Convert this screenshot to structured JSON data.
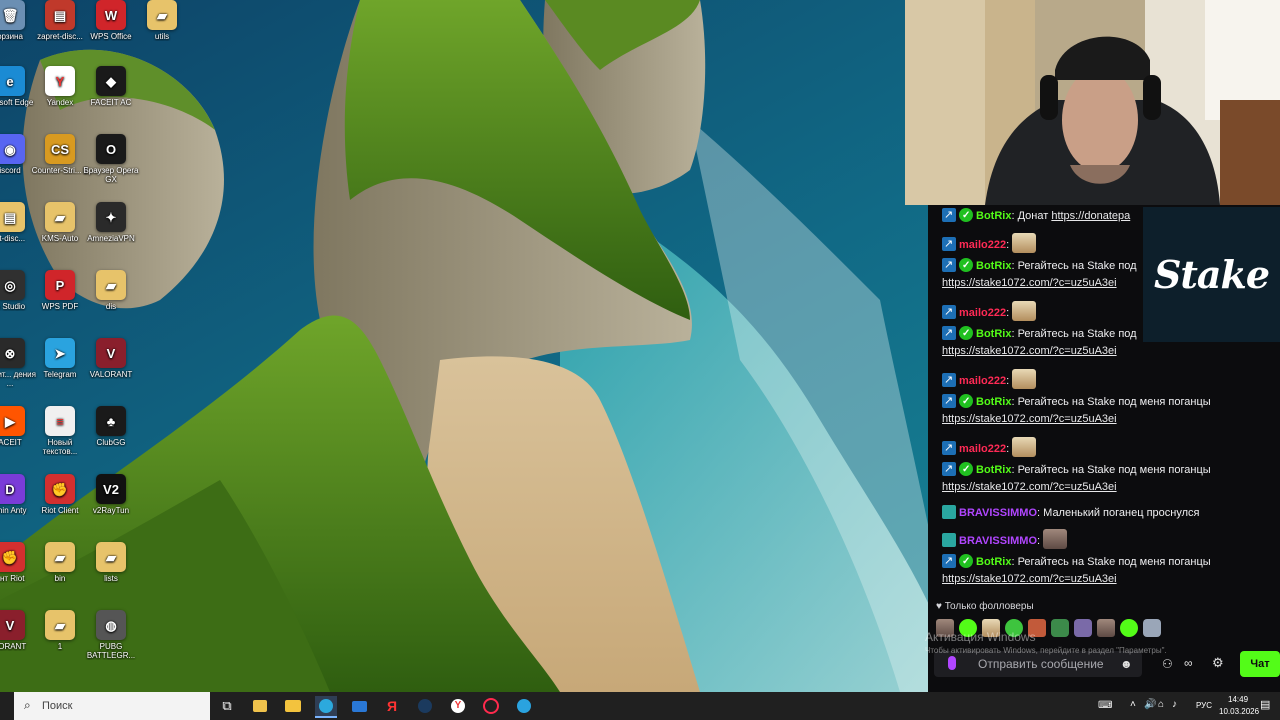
{
  "desktop": {
    "icons": [
      {
        "label": "орзина",
        "color": "#6b8fb3",
        "glyph": "🗑"
      },
      {
        "label": "zapret-disc...",
        "color": "#c0392b",
        "glyph": "▤"
      },
      {
        "label": "WPS Office",
        "color": "#d0252a",
        "glyph": "W"
      },
      {
        "label": "utils",
        "color": "#e7c36a",
        "glyph": "▰"
      },
      {
        "label": "icrosoft Edge",
        "color": "#1b8bd4",
        "glyph": "e"
      },
      {
        "label": "Yandex",
        "color": "#ffffff",
        "glyph": "Y"
      },
      {
        "label": "FACEIT AC",
        "color": "#1a1a1a",
        "glyph": "◆"
      },
      {
        "label": "iscord",
        "color": "#5865f2",
        "glyph": "◉"
      },
      {
        "label": "Counter-Stri... 2",
        "color": "#d89a20",
        "glyph": "CS"
      },
      {
        "label": "Браузер Opera GX",
        "color": "#1a1a1a",
        "glyph": "O"
      },
      {
        "label": "et-disc...",
        "color": "#e7c36a",
        "glyph": "▤"
      },
      {
        "label": "KMS-Auto",
        "color": "#e7c36a",
        "glyph": "▰"
      },
      {
        "label": "AmneziaVPN",
        "color": "#2a2a2a",
        "glyph": "✦"
      },
      {
        "label": "S Studio",
        "color": "#303030",
        "glyph": "◎"
      },
      {
        "label": "WPS PDF",
        "color": "#d0252a",
        "glyph": "P"
      },
      {
        "label": "dis",
        "color": "#e7c36a",
        "glyph": "▰"
      },
      {
        "label": "олнит... дения ...",
        "color": "#2a2a2a",
        "glyph": "⊗"
      },
      {
        "label": "Telegram",
        "color": "#2aa3df",
        "glyph": "➤"
      },
      {
        "label": "VALORANT",
        "color": "#8a1f2c",
        "glyph": "V"
      },
      {
        "label": "ACEIT",
        "color": "#ff5500",
        "glyph": "▶"
      },
      {
        "label": "Новый текстов...",
        "color": "#f0f0f0",
        "glyph": "≡"
      },
      {
        "label": "ClubGG",
        "color": "#1a1a1a",
        "glyph": "♣"
      },
      {
        "label": "phin Anty",
        "color": "#7a3cd8",
        "glyph": "D"
      },
      {
        "label": "Riot Client",
        "color": "#d32f2f",
        "glyph": "✊"
      },
      {
        "label": "v2RayTun",
        "color": "#111111",
        "glyph": "V2"
      },
      {
        "label": "ент Riot",
        "color": "#d32f2f",
        "glyph": "✊"
      },
      {
        "label": "bin",
        "color": "#e7c36a",
        "glyph": "▰"
      },
      {
        "label": "lists",
        "color": "#e7c36a",
        "glyph": "▰"
      },
      {
        "label": "LORANT",
        "color": "#8a1f2c",
        "glyph": "V"
      },
      {
        "label": "1",
        "color": "#e7c36a",
        "glyph": "▰"
      },
      {
        "label": "PUBG BATTLEGR...",
        "color": "#555555",
        "glyph": "◍"
      }
    ]
  },
  "chat": {
    "messages": [
      {
        "type": "bot",
        "user": "BotRix",
        "user_color": "#53fc18",
        "text": "Донат",
        "link": "https://donatepa"
      },
      {
        "type": "emote",
        "user": "mailo222",
        "user_color": "#ff2a55"
      },
      {
        "type": "bot",
        "user": "BotRix",
        "user_color": "#53fc18",
        "text": "Регайтесь на Stake под",
        "link": "https://stake1072.com/?c=uz5uA3ei"
      },
      {
        "type": "emote",
        "user": "mailo222",
        "user_color": "#ff2a55"
      },
      {
        "type": "bot",
        "user": "BotRix",
        "user_color": "#53fc18",
        "text": "Регайтесь на Stake под",
        "link": "https://stake1072.com/?c=uz5uA3ei"
      },
      {
        "type": "emote",
        "user": "mailo222",
        "user_color": "#ff2a55"
      },
      {
        "type": "bot",
        "user": "BotRix",
        "user_color": "#53fc18",
        "text": "Регайтесь на Stake под меня поганцы",
        "link": "https://stake1072.com/?c=uz5uA3ei"
      },
      {
        "type": "emote",
        "user": "mailo222",
        "user_color": "#ff2a55"
      },
      {
        "type": "bot",
        "user": "BotRix",
        "user_color": "#53fc18",
        "text": "Регайтесь на Stake под меня поганцы",
        "link": "https://stake1072.com/?c=uz5uA3ei"
      },
      {
        "type": "text",
        "user": "BRAVISSIMMO",
        "user_color": "#b146ff",
        "text": "Маленький поганец проснулся"
      },
      {
        "type": "emote2",
        "user": "BRAVISSIMMO",
        "user_color": "#b146ff"
      },
      {
        "type": "bot",
        "user": "BotRix",
        "user_color": "#53fc18",
        "text": "Регайтесь на Stake под меня поганцы",
        "link": "https://stake1072.com/?c=uz5uA3ei"
      }
    ],
    "followers_only": "Только фолловеры",
    "input_placeholder": "Отправить сообщение",
    "send_label": "Чат",
    "stake_logo": "Stake"
  },
  "watermark": {
    "title": "Активация Windows",
    "subtitle": "Чтобы активировать Windows, перейдите в раздел \"Параметры\"."
  },
  "taskbar": {
    "search_placeholder": "Поиск",
    "lang": "РУС",
    "time": "14:49",
    "date": "10.03.2026"
  },
  "colors": {
    "accent_green": "#53fc18",
    "chat_bg": "#0c0c0e",
    "taskbar_bg": "#202020"
  }
}
